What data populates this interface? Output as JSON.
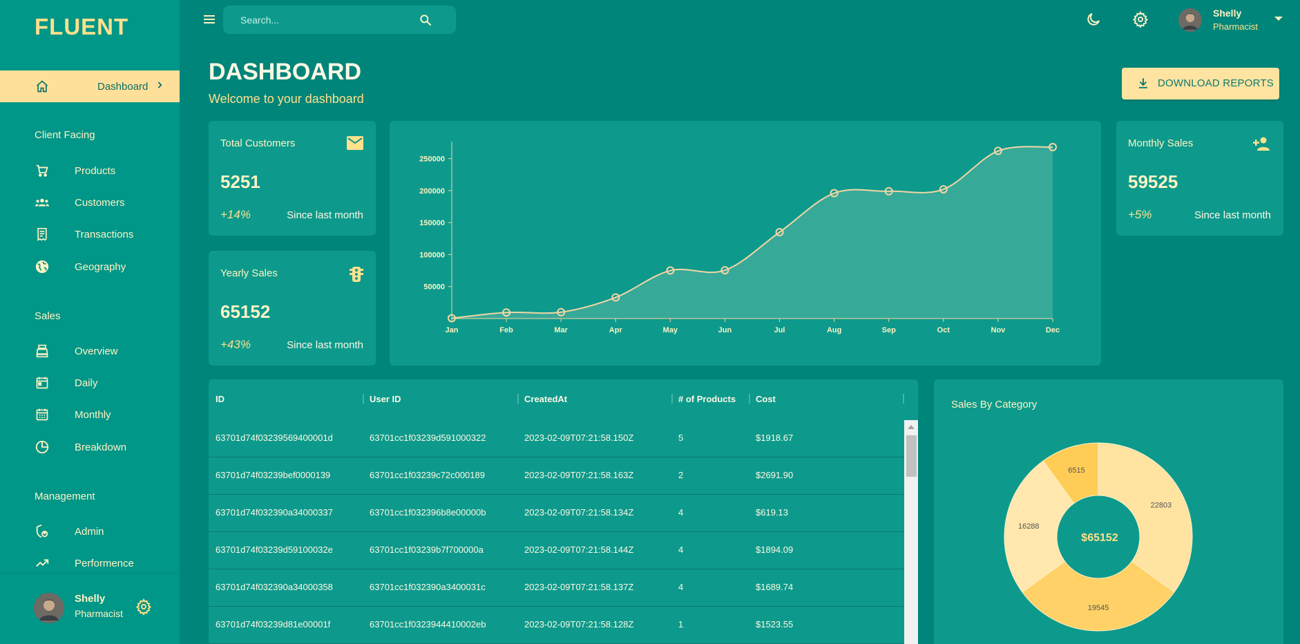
{
  "app": {
    "brand": "FLUENT"
  },
  "search": {
    "placeholder": "Search..."
  },
  "user": {
    "name": "Shelly",
    "role": "Pharmacist"
  },
  "sidebar": {
    "active": {
      "label": "Dashboard",
      "icon": "home-icon"
    },
    "sections": [
      {
        "title": "Client Facing",
        "items": [
          {
            "label": "Products",
            "icon": "cart-icon"
          },
          {
            "label": "Customers",
            "icon": "groups-icon"
          },
          {
            "label": "Transactions",
            "icon": "receipt-icon"
          },
          {
            "label": "Geography",
            "icon": "globe-icon"
          }
        ]
      },
      {
        "title": "Sales",
        "items": [
          {
            "label": "Overview",
            "icon": "point-of-sale-icon"
          },
          {
            "label": "Daily",
            "icon": "calendar-today-icon"
          },
          {
            "label": "Monthly",
            "icon": "calendar-month-icon"
          },
          {
            "label": "Breakdown",
            "icon": "pie-chart-icon"
          }
        ]
      },
      {
        "title": "Management",
        "items": [
          {
            "label": "Admin",
            "icon": "admin-icon"
          },
          {
            "label": "Performence",
            "icon": "trending-up-icon"
          }
        ]
      }
    ]
  },
  "header": {
    "title": "DASHBOARD",
    "subtitle": "Welcome to your dashboard",
    "download_label": "DOWNLOAD REPORTS"
  },
  "stats": {
    "total_customers": {
      "title": "Total Customers",
      "value": "5251",
      "change": "+14%",
      "since": "Since last month",
      "icon": "email-icon"
    },
    "yearly_sales": {
      "title": "Yearly Sales",
      "value": "65152",
      "change": "+43%",
      "since": "Since last month",
      "icon": "traffic-icon"
    },
    "monthly_sales": {
      "title": "Monthly Sales",
      "value": "59525",
      "change": "+5%",
      "since": "Since last month",
      "icon": "person-add-icon"
    }
  },
  "chart_data": [
    {
      "type": "area",
      "categories": [
        "Jan",
        "Feb",
        "Mar",
        "Apr",
        "May",
        "Jun",
        "Jul",
        "Aug",
        "Sep",
        "Oct",
        "Nov",
        "Dec"
      ],
      "series": [
        {
          "values": [
            500,
            9500,
            10000,
            33000,
            75000,
            75500,
            135000,
            196000,
            199000,
            202000,
            262000,
            268000
          ]
        }
      ],
      "yticks": [
        50000,
        100000,
        150000,
        200000,
        250000
      ],
      "ylim": [
        0,
        270000
      ],
      "xlabel": "",
      "ylabel": "",
      "grid": false,
      "colors": {
        "line": "#f5d6a4",
        "fill": "#5bb7a2"
      }
    },
    {
      "type": "pie",
      "title": "Sales By Category",
      "center_label": "$65152",
      "slices": [
        {
          "value": 22803,
          "label": "22803",
          "color": "#ffe3a1"
        },
        {
          "value": 19545,
          "label": "19545",
          "color": "#ffd166"
        },
        {
          "value": 16288,
          "label": "16288",
          "color": "#ffe7ad"
        },
        {
          "value": 6515,
          "label": "6515",
          "color": "#ffcd55"
        }
      ]
    }
  ],
  "table": {
    "columns": [
      "ID",
      "User ID",
      "CreatedAt",
      "# of Products",
      "Cost"
    ],
    "rows": [
      [
        "63701d74f03239569400001d",
        "63701cc1f03239d591000322",
        "2023-02-09T07:21:58.150Z",
        "5",
        "$1918.67"
      ],
      [
        "63701d74f03239bef0000139",
        "63701cc1f03239c72c000189",
        "2023-02-09T07:21:58.163Z",
        "2",
        "$2691.90"
      ],
      [
        "63701d74f032390a34000337",
        "63701cc1f032396b8e00000b",
        "2023-02-09T07:21:58.134Z",
        "4",
        "$619.13"
      ],
      [
        "63701d74f03239d59100032e",
        "63701cc1f03239b7f700000a",
        "2023-02-09T07:21:58.144Z",
        "4",
        "$1894.09"
      ],
      [
        "63701d74f032390a34000358",
        "63701cc1f032390a3400031c",
        "2023-02-09T07:21:58.137Z",
        "4",
        "$1689.74"
      ],
      [
        "63701d74f03239d81e00001f",
        "63701cc1f0323944410002eb",
        "2023-02-09T07:21:58.128Z",
        "1",
        "$1523.55"
      ]
    ]
  }
}
